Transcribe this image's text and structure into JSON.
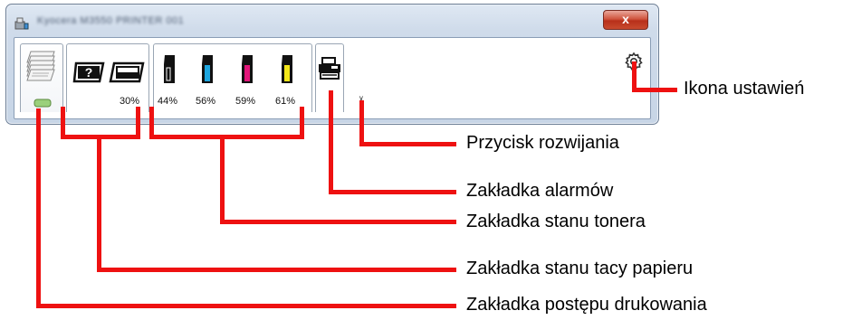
{
  "title_bar": {
    "title": "Kyocera M3550 PRINTER 001",
    "close_label": "x"
  },
  "tabs": {
    "print_progress": {
      "icon": "page-stack-icon",
      "status": "paper-tray-led-icon"
    },
    "paper_tray": {
      "percent": "30%",
      "icons": [
        "unknown-tray-icon",
        "paper-tray-icon"
      ]
    },
    "toner": {
      "items": [
        {
          "color": "#111111",
          "percent": "44%"
        },
        {
          "color": "#1ea6df",
          "percent": "56%"
        },
        {
          "color": "#e2167a",
          "percent": "59%"
        },
        {
          "color": "#f2e61a",
          "percent": "61%"
        }
      ]
    },
    "alarm": {
      "icon": "printer-icon"
    }
  },
  "settings_icon": "gear-icon",
  "expand_glyph": "∨",
  "callouts": {
    "settings": "Ikona ustawień",
    "expand": "Przycisk rozwijania",
    "alarm": "Zakładka alarmów",
    "toner": "Zakładka stanu tonera",
    "paper_tray": "Zakładka stanu tacy papieru",
    "print_progress": "Zakładka postępu drukowania"
  },
  "colors": {
    "callout_line": "#ee1111"
  }
}
